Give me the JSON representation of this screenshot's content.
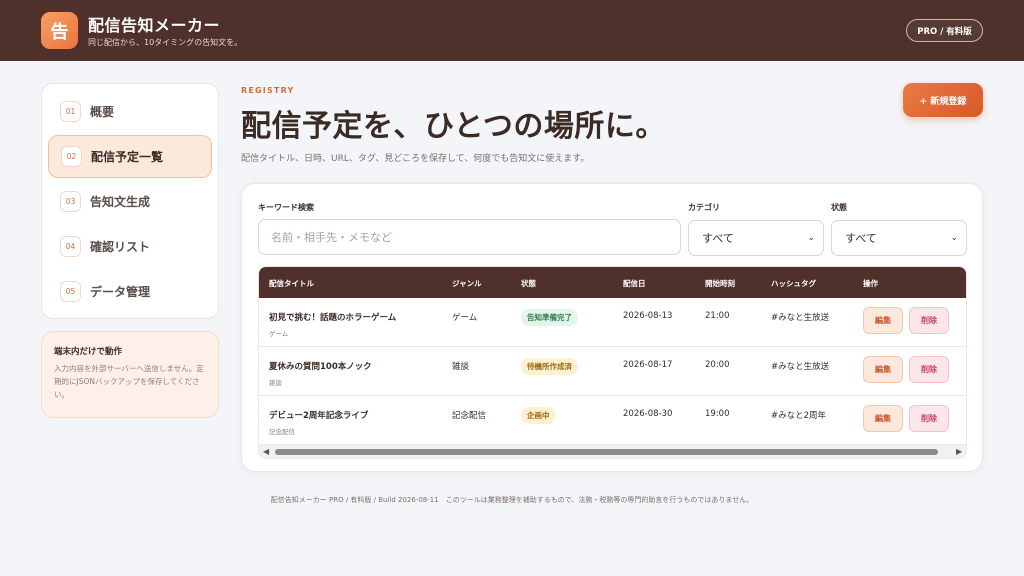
{
  "app": {
    "logo_glyph": "告",
    "title": "配信告知メーカー",
    "subtitle": "同じ配信から、10タイミングの告知文を。",
    "plan_badge": "PRO / 有料版"
  },
  "sidebar": {
    "items": [
      {
        "num": "01",
        "label": "概要"
      },
      {
        "num": "02",
        "label": "配信予定一覧",
        "active": true
      },
      {
        "num": "03",
        "label": "告知文生成"
      },
      {
        "num": "04",
        "label": "確認リスト"
      },
      {
        "num": "05",
        "label": "データ管理"
      }
    ],
    "note": {
      "title": "端末内だけで動作",
      "body": "入力内容を外部サーバーへ送信しません。定期的にJSONバックアップを保存してください。"
    }
  },
  "main": {
    "eyebrow": "REGISTRY",
    "title": "配信予定を、ひとつの場所に。",
    "description": "配信タイトル、日時、URL、タグ、見どころを保存して、何度でも告知文に使えます。",
    "new_button": "+ 新規登録"
  },
  "filters": {
    "keyword_label": "キーワード検索",
    "keyword_placeholder": "名前・相手先・メモなど",
    "keyword_value": "",
    "category_label": "カテゴリ",
    "category_value": "すべて",
    "status_label": "状態",
    "status_value": "すべて"
  },
  "table": {
    "headers": [
      "配信タイトル",
      "ジャンル",
      "状態",
      "配信日",
      "開始時刻",
      "ハッシュタグ",
      "操作"
    ],
    "rows": [
      {
        "title": "初見で挑む！話題のホラーゲーム",
        "sub": "ゲーム",
        "genre": "ゲーム",
        "status": "告知準備完了",
        "status_color": "green",
        "date": "2026-08-13",
        "time": "21:00",
        "hashtag": "#みなと生放送"
      },
      {
        "title": "夏休みの質問100本ノック",
        "sub": "雑談",
        "genre": "雑談",
        "status": "待機所作成済",
        "status_color": "yellow",
        "date": "2026-08-17",
        "time": "20:00",
        "hashtag": "#みなと生放送"
      },
      {
        "title": "デビュー2周年記念ライブ",
        "sub": "記念配信",
        "genre": "記念配信",
        "status": "企画中",
        "status_color": "yellow",
        "date": "2026-08-30",
        "time": "19:00",
        "hashtag": "#みなと2周年"
      }
    ],
    "edit_label": "編集",
    "delete_label": "削除"
  },
  "footer": {
    "text": "配信告知メーカー PRO / 有料版 / Build 2026-08-11　このツールは業務整理を補助するもので、法務・税務等の専門的助言を行うものではありません。"
  },
  "colors": {
    "header_bg": "#50302a",
    "accent": "#d7592a",
    "status_green": "#2e7d4f",
    "status_yellow": "#9a6a12"
  }
}
